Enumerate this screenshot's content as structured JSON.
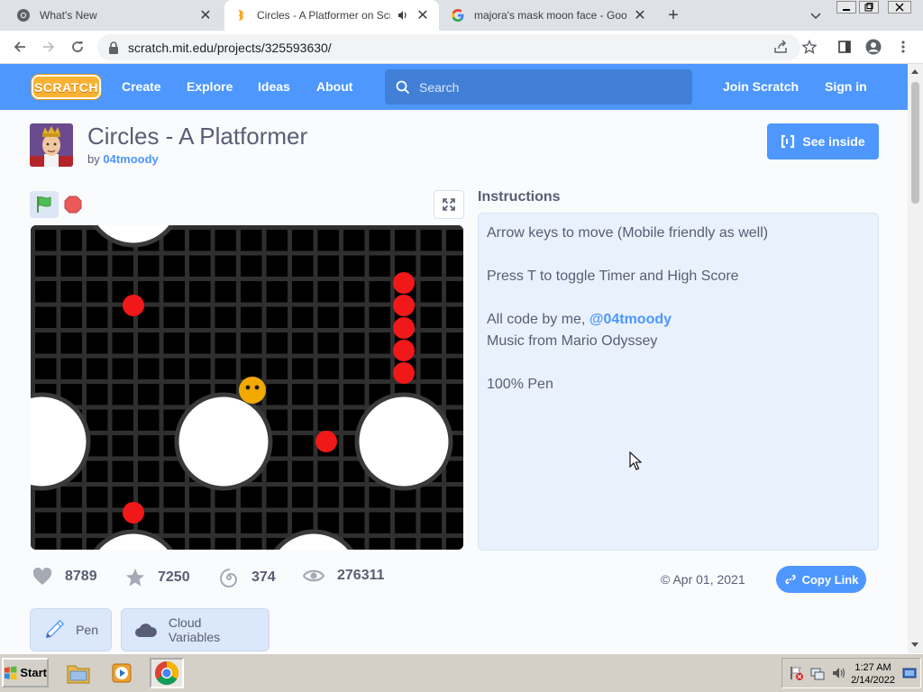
{
  "browser": {
    "tabs": [
      {
        "title": "What's New",
        "active": false
      },
      {
        "title": "Circles - A Platformer on Scratch",
        "active": true
      },
      {
        "title": "majora's mask moon face - Google Search",
        "active": false
      }
    ],
    "url": "scratch.mit.edu/projects/325593630/"
  },
  "nav": {
    "logo": "SCRATCH",
    "links": [
      "Create",
      "Explore",
      "Ideas",
      "About"
    ],
    "search_placeholder": "Search",
    "join": "Join Scratch",
    "signin": "Sign in"
  },
  "project": {
    "title": "Circles - A Platformer",
    "by_prefix": "by",
    "author": "04tmoody",
    "see_inside": "See inside"
  },
  "instructions": {
    "heading": "Instructions",
    "line1": "Arrow keys to move (Mobile friendly as well)",
    "line2": "Press T to toggle Timer and High Score",
    "line3_prefix": "All code by me,",
    "line3_link": "@04tmoody",
    "line4": "Music from Mario Odyssey",
    "line5": "100% Pen"
  },
  "stats": {
    "loves": "8789",
    "favorites": "7250",
    "remixes": "374",
    "views": "276311",
    "date": "Apr 01, 2021",
    "copy_link": "Copy Link"
  },
  "tags": [
    "Pen",
    "Cloud Variables"
  ],
  "taskbar": {
    "start": "Start",
    "time": "1:27 AM",
    "date": "2/14/2022"
  },
  "colors": {
    "scratch_blue": "#4d97ff",
    "text": "#575e75",
    "instructions_bg": "#e9f1fc"
  }
}
